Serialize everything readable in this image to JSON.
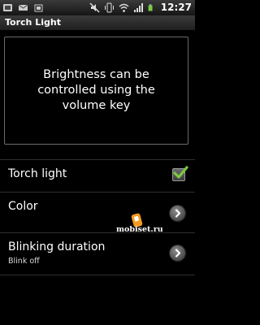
{
  "status_bar": {
    "time": "12:27",
    "left_icons": [
      "phone-icon",
      "sms-icon",
      "carrier-icon"
    ],
    "right_icons": [
      "mute-icon",
      "vibrate-icon",
      "wifi-icon",
      "signal-icon",
      "battery-icon"
    ]
  },
  "app": {
    "title": "Torch Light"
  },
  "message": "Brightness can be controlled using the volume key",
  "settings": [
    {
      "label": "Torch light",
      "control": "checkbox",
      "checked": true
    },
    {
      "label": "Color",
      "control": "arrow"
    },
    {
      "label": "Blinking duration",
      "summary": "Blink off",
      "control": "arrow"
    }
  ],
  "watermark": "mobiset.ru",
  "colors": {
    "accent_check": "#7ac943",
    "background": "#000000"
  }
}
